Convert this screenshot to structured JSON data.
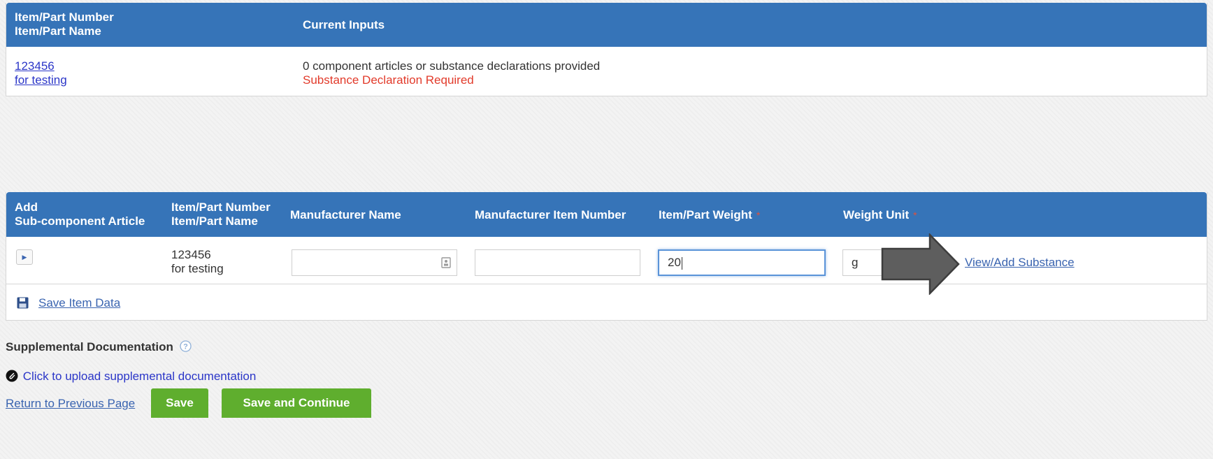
{
  "top_table": {
    "header": {
      "col1_line1": "Item/Part Number",
      "col1_line2": "Item/Part Name",
      "col2": "Current Inputs"
    },
    "row": {
      "part_number": "123456",
      "part_name": "for testing",
      "inputs_text": "0 component articles or substance declarations provided",
      "warning": "Substance Declaration Required"
    }
  },
  "component_table": {
    "header": {
      "add_line1": "Add",
      "add_line2": "Sub-component Article",
      "part_line1": "Item/Part Number",
      "part_line2": "Item/Part Name",
      "manufacturer_name": "Manufacturer Name",
      "manufacturer_item_number": "Manufacturer Item Number",
      "part_weight": "Item/Part Weight",
      "weight_unit": "Weight Unit",
      "required_mark": "*"
    },
    "row": {
      "part_number": "123456",
      "part_name": "for testing",
      "manufacturer_name_value": "",
      "manufacturer_item_number_value": "",
      "part_weight_value": "20",
      "weight_unit_value": "g",
      "view_add_link": "View/Add Substance"
    },
    "save_item_data": "Save Item Data"
  },
  "supplemental": {
    "title": "Supplemental Documentation",
    "upload_link": "Click to upload supplemental documentation"
  },
  "footer": {
    "return_link": "Return to Previous Page",
    "save_button": "Save",
    "save_continue_button": "Save and Continue"
  },
  "colors": {
    "header_blue": "#3674b8",
    "green_button": "#5fae2e",
    "warning_red": "#e23a2a",
    "arrow_gray": "#5e5e5e"
  },
  "icons": {
    "expander": "triangle-right-icon",
    "save": "floppy-disk-icon",
    "help": "question-circle-icon",
    "attach": "paperclip-icon",
    "contact_card": "contact-card-icon",
    "annotation": "arrow-right-icon"
  }
}
